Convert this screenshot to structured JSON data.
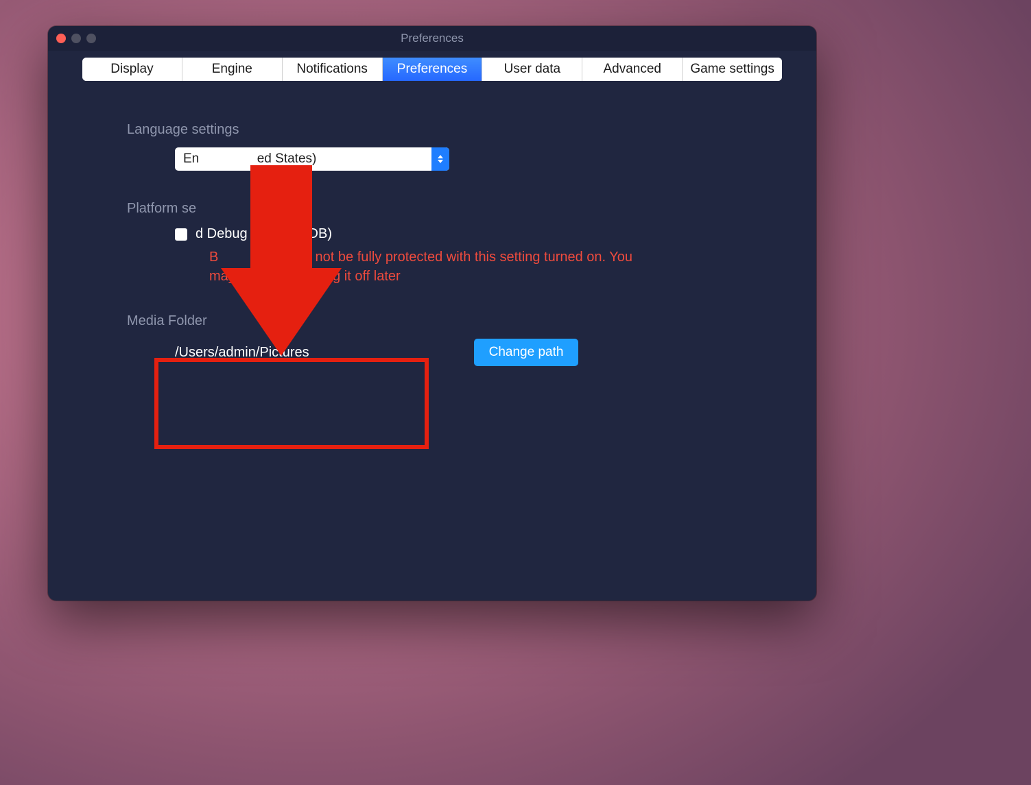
{
  "window": {
    "title": "Preferences"
  },
  "tabs": {
    "display": "Display",
    "engine": "Engine",
    "notifications": "Notifications",
    "preferences": "Preferences",
    "userdata": "User data",
    "advanced": "Advanced",
    "gamesettings": "Game settings"
  },
  "language": {
    "section_label": "Language settings",
    "selected_full": "English (United States)",
    "selected_prefix": "En",
    "selected_suffix": "ed States)"
  },
  "platform": {
    "section_label": "Platform settings",
    "section_label_visible": "Platform se",
    "adb_label": "d Debug Bridge (ADB)",
    "warning_line1_prefix": "B",
    "warning_line1_mid": " may not be fully protected with this setting turned on. You",
    "warning_line2_prefix": "may",
    "warning_line2_suffix": "sider turning it off later"
  },
  "media": {
    "section_label": "Media Folder",
    "path": "/Users/admin/Pictures",
    "change_btn": "Change path"
  }
}
